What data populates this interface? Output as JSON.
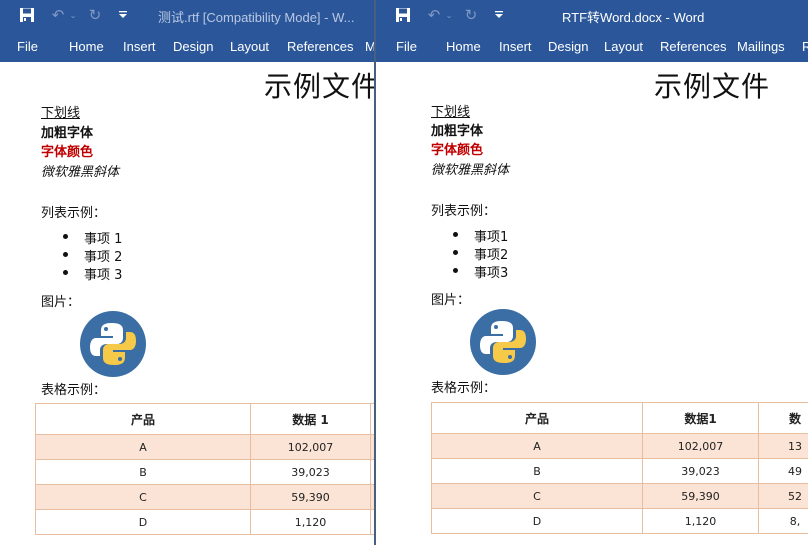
{
  "windows": [
    {
      "title": "测试.rtf [Compatibility Mode]  -  W...",
      "tabs": [
        "File",
        "Home",
        "Insert",
        "Design",
        "Layout",
        "References",
        "M"
      ],
      "document": {
        "heading": "示例文件",
        "underline_text": "下划线",
        "bold_text": "加粗字体",
        "color_text": "字体颜色",
        "italic_text": "微软雅黑斜体",
        "list_label": "列表示例：",
        "list_items": [
          "事项 1",
          "事项 2",
          "事项 3"
        ],
        "image_label": "图片：",
        "table_label": "表格示例：",
        "table": {
          "headers": [
            "产品",
            "数据 1",
            ""
          ],
          "rows": [
            [
              "A",
              "102,007",
              ""
            ],
            [
              "B",
              "39,023",
              ""
            ],
            [
              "C",
              "59,390",
              ""
            ],
            [
              "D",
              "1,120",
              ""
            ]
          ]
        }
      }
    },
    {
      "title": "RTF转Word.docx  -  Word",
      "tabs": [
        "File",
        "Home",
        "Insert",
        "Design",
        "Layout",
        "References",
        "Mailings",
        "R"
      ],
      "document": {
        "heading": "示例文件",
        "underline_text": "下划线",
        "bold_text": "加粗字体",
        "color_text": "字体颜色",
        "italic_text": "微软雅黑斜体",
        "list_label": "列表示例：",
        "list_items": [
          "事项1",
          "事项2",
          "事项3"
        ],
        "image_label": "图片：",
        "table_label": "表格示例：",
        "table": {
          "headers": [
            "产品",
            "数据1",
            "数"
          ],
          "rows": [
            [
              "A",
              "102,007",
              "13"
            ],
            [
              "B",
              "39,023",
              "49"
            ],
            [
              "C",
              "59,390",
              "52"
            ],
            [
              "D",
              "1,120",
              "8,"
            ]
          ]
        }
      }
    }
  ],
  "icons": {
    "save": "save-icon",
    "undo": "undo-icon",
    "redo": "redo-icon",
    "customize": "customize-qat-icon",
    "python_logo": "python-logo-image"
  },
  "colors": {
    "ribbon": "#2b579a",
    "table_border": "#e7bfa0",
    "table_shade": "#fbe4d5",
    "red_text": "#c00000"
  }
}
